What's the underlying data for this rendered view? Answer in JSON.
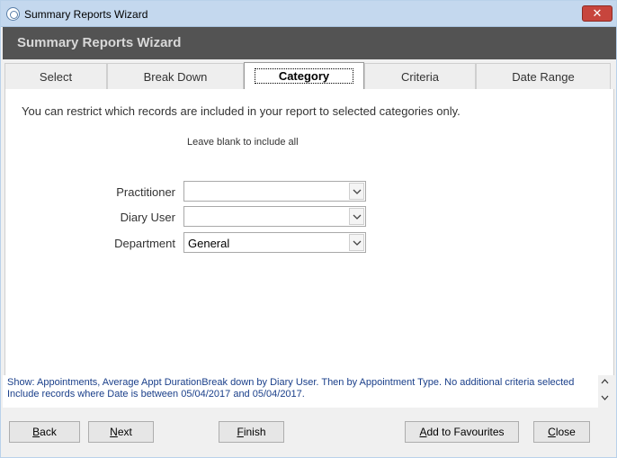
{
  "window": {
    "title": "Summary Reports Wizard",
    "close_glyph": "✕"
  },
  "header": {
    "title": "Summary Reports Wizard"
  },
  "tabs": [
    {
      "label": "Select"
    },
    {
      "label": "Break Down"
    },
    {
      "label": "Category"
    },
    {
      "label": "Criteria"
    },
    {
      "label": "Date Range"
    }
  ],
  "active_tab": "Category",
  "category": {
    "intro": "You can restrict which records are included in your report to selected categories only.",
    "hint": "Leave blank to include all",
    "fields": [
      {
        "label": "Practitioner",
        "value": ""
      },
      {
        "label": "Diary User",
        "value": ""
      },
      {
        "label": "Department",
        "value": "General"
      }
    ]
  },
  "summary": {
    "text": "Show: Appointments, Average Appt DurationBreak down by Diary User. Then by Appointment Type. No additional criteria selected Include records where Date is between 05/04/2017 and 05/04/2017."
  },
  "footer": {
    "back": {
      "label_first": "B",
      "label_rest": "ack"
    },
    "next": {
      "label_first": "N",
      "label_rest": "ext"
    },
    "finish": {
      "label_first": "F",
      "label_rest": "inish"
    },
    "add_favourites": {
      "label_first": "A",
      "label_rest": "dd to Favourites"
    },
    "close": {
      "label_first": "C",
      "label_rest": "lose"
    }
  },
  "icons": {
    "app": "app-icon",
    "close": "close-icon",
    "dropdown": "chevron-down-icon",
    "scroll_up": "scroll-up-icon",
    "scroll_down": "scroll-down-icon"
  },
  "colors": {
    "header_bg": "#535353",
    "close_button": "#c7453d",
    "summary_text": "#1a3f8a"
  }
}
